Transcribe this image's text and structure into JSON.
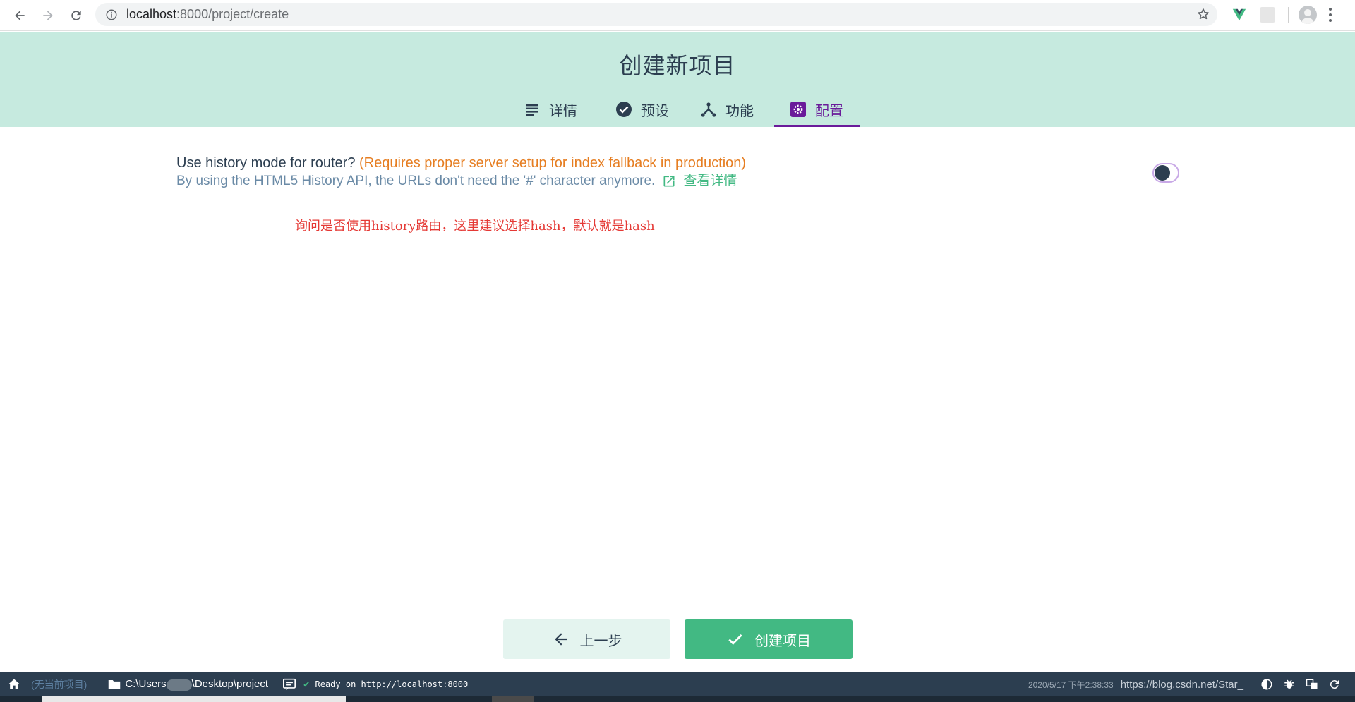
{
  "browser": {
    "url_host": "localhost",
    "url_rest": ":8000/project/create"
  },
  "header": {
    "title": "创建新项目",
    "tabs": [
      {
        "label": "详情",
        "icon": "list-icon"
      },
      {
        "label": "预设",
        "icon": "check-circle-icon"
      },
      {
        "label": "功能",
        "icon": "fork-icon"
      },
      {
        "label": "配置",
        "icon": "gear-icon"
      }
    ],
    "active_tab": "配置"
  },
  "option": {
    "title": "Use history mode for router?",
    "warning": "(Requires proper server setup for index fallback in production)",
    "description": "By using the HTML5 History API, the URLs don't need the '#' character anymore.",
    "more_link": "查看详情",
    "enabled": false
  },
  "annotation": "询问是否使用history路由，这里建议选择hash，默认就是hash",
  "footer": {
    "prev_label": "上一步",
    "create_label": "创建项目"
  },
  "statusbar": {
    "no_project": "(无当前项目)",
    "path_start": "C:\\Users",
    "path_end": "\\Desktop\\project",
    "ready": "Ready on http://localhost:8000",
    "datetime": "2020/5/17 下午2:38:33",
    "watermark": "https://blog.csdn.net/Star_"
  },
  "colors": {
    "header_bg": "#c6eadf",
    "accent_purple": "#6a1b9a",
    "primary_green": "#42b983",
    "warning_orange": "#e67e22",
    "annotation_red": "#e53935",
    "statusbar_bg": "#2c3e50"
  }
}
